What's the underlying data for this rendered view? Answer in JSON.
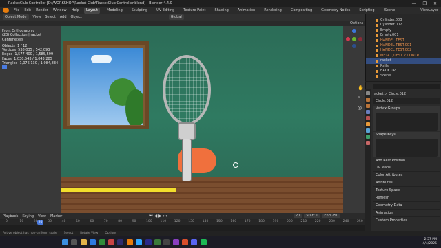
{
  "window": {
    "title": "RacketClub Controller [D:\\WORKSHOP\\Racket Club\\RacketClub Controller.blend] - Blender 4.4.0",
    "controls": [
      "—",
      "❐",
      "✕"
    ]
  },
  "menu": {
    "items": [
      "File",
      "Edit",
      "Render",
      "Window",
      "Help"
    ],
    "workspaces": [
      "Layout",
      "Modeling",
      "Sculpting",
      "UV Editing",
      "Texture Paint",
      "Shading",
      "Animation",
      "Rendering",
      "Compositing",
      "Geometry Nodes",
      "Scripting"
    ],
    "active_workspace": "Layout",
    "scene": "Scene",
    "view_layer": "ViewLayer"
  },
  "viewport_header": {
    "mode": "Object Mode",
    "menus": [
      "View",
      "Select",
      "Add",
      "Object"
    ],
    "orientation": "Global",
    "options": "Options"
  },
  "viewport_info": {
    "view": "Front Orthographic",
    "collection": "(20) Collection | racket",
    "units": "Centimeters",
    "stats": [
      {
        "label": "Objects",
        "value": "1 / 12"
      },
      {
        "label": "Vertices",
        "value": "538,035 / 542,093"
      },
      {
        "label": "Edges",
        "value": "1,577,400 / 1,585,599"
      },
      {
        "label": "Faces",
        "value": "1,030,543 / 1,043,285"
      },
      {
        "label": "Triangles",
        "value": "1,076,130 / 1,084,834"
      }
    ]
  },
  "outliner": {
    "items": [
      {
        "label": "Cylinder.003",
        "state": ""
      },
      {
        "label": "Cylinder.002",
        "state": ""
      },
      {
        "label": "Empty",
        "state": ""
      },
      {
        "label": "Empty.001",
        "state": ""
      },
      {
        "label": "HANDEL TEST",
        "state": "hl"
      },
      {
        "label": "HANDEL TEST.001",
        "state": "hl"
      },
      {
        "label": "HANDEL TEST.002",
        "state": "hl"
      },
      {
        "label": "META QUEST 2 CONTR",
        "state": "hl"
      },
      {
        "label": "racket",
        "state": "sel"
      },
      {
        "label": "Rails",
        "state": ""
      },
      {
        "label": "BACK UP",
        "state": ""
      },
      {
        "label": "Scene",
        "state": ""
      }
    ]
  },
  "properties": {
    "search_placeholder": "",
    "breadcrumb": [
      "racket",
      "Circle.012"
    ],
    "mesh_name": "Circle.012",
    "vertex_groups": "Vertex Groups",
    "shape_keys": "Shape Keys",
    "add_rest_position": "Add Rest Position",
    "sections": [
      "UV Maps",
      "Color Attributes",
      "Attributes",
      "Texture Space",
      "Remesh",
      "Geometry Data",
      "Animation",
      "Custom Properties"
    ]
  },
  "timeline": {
    "menus": [
      "Playback",
      "Keying",
      "View",
      "Marker"
    ],
    "current_frame": "20",
    "ruler_ticks": [
      "0",
      "10",
      "20",
      "30",
      "40",
      "50",
      "60",
      "70",
      "80",
      "90",
      "100",
      "110",
      "120",
      "130",
      "140",
      "150",
      "160",
      "170",
      "180",
      "190",
      "200",
      "210",
      "220",
      "230",
      "240",
      "250"
    ],
    "frame_field": "20",
    "start_label": "Start",
    "start_value": "1",
    "end_label": "End",
    "end_value": "250"
  },
  "statusbar": {
    "warning": "Active object has non-uniform scale",
    "items": [
      "Select",
      "Rotate View",
      "Options"
    ]
  },
  "taskbar": {
    "time": "2:57 PM",
    "date": "4/4/2025"
  },
  "colors": {
    "accent": "#4a7be0",
    "blender_orange": "#e87d0d",
    "selected_row": "#334d80",
    "highlight_text": "#e8904c"
  }
}
